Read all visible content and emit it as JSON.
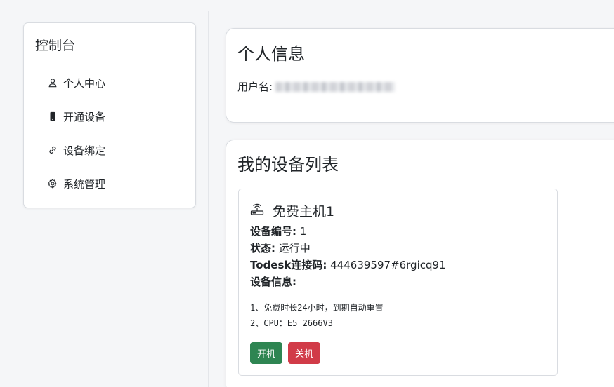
{
  "sidebar": {
    "title": "控制台",
    "items": [
      {
        "label": "个人中心",
        "icon": "user-icon"
      },
      {
        "label": "开通设备",
        "icon": "phone-icon"
      },
      {
        "label": "设备绑定",
        "icon": "link-icon"
      },
      {
        "label": "系统管理",
        "icon": "gear-icon"
      }
    ]
  },
  "profile": {
    "title": "个人信息",
    "username_label": "用户名:",
    "username_value_redacted": true
  },
  "devices": {
    "title": "我的设备列表",
    "list": [
      {
        "name": "免费主机1",
        "icon": "router-icon",
        "id_label": "设备编号:",
        "id_value": "1",
        "status_label": "状态:",
        "status_value": "运行中",
        "todesk_label": "Todesk连接码:",
        "todesk_value": "444639597#6rgicq91",
        "info_label": "设备信息:",
        "info_lines": [
          "1、免费时长24小时，到期自动重置",
          "2、CPU：E5 2666V3"
        ],
        "power_on_label": "开机",
        "power_off_label": "关机"
      }
    ]
  },
  "colors": {
    "power_on": "#2e8552",
    "power_off": "#d13b48",
    "background": "#f5f6f8"
  }
}
